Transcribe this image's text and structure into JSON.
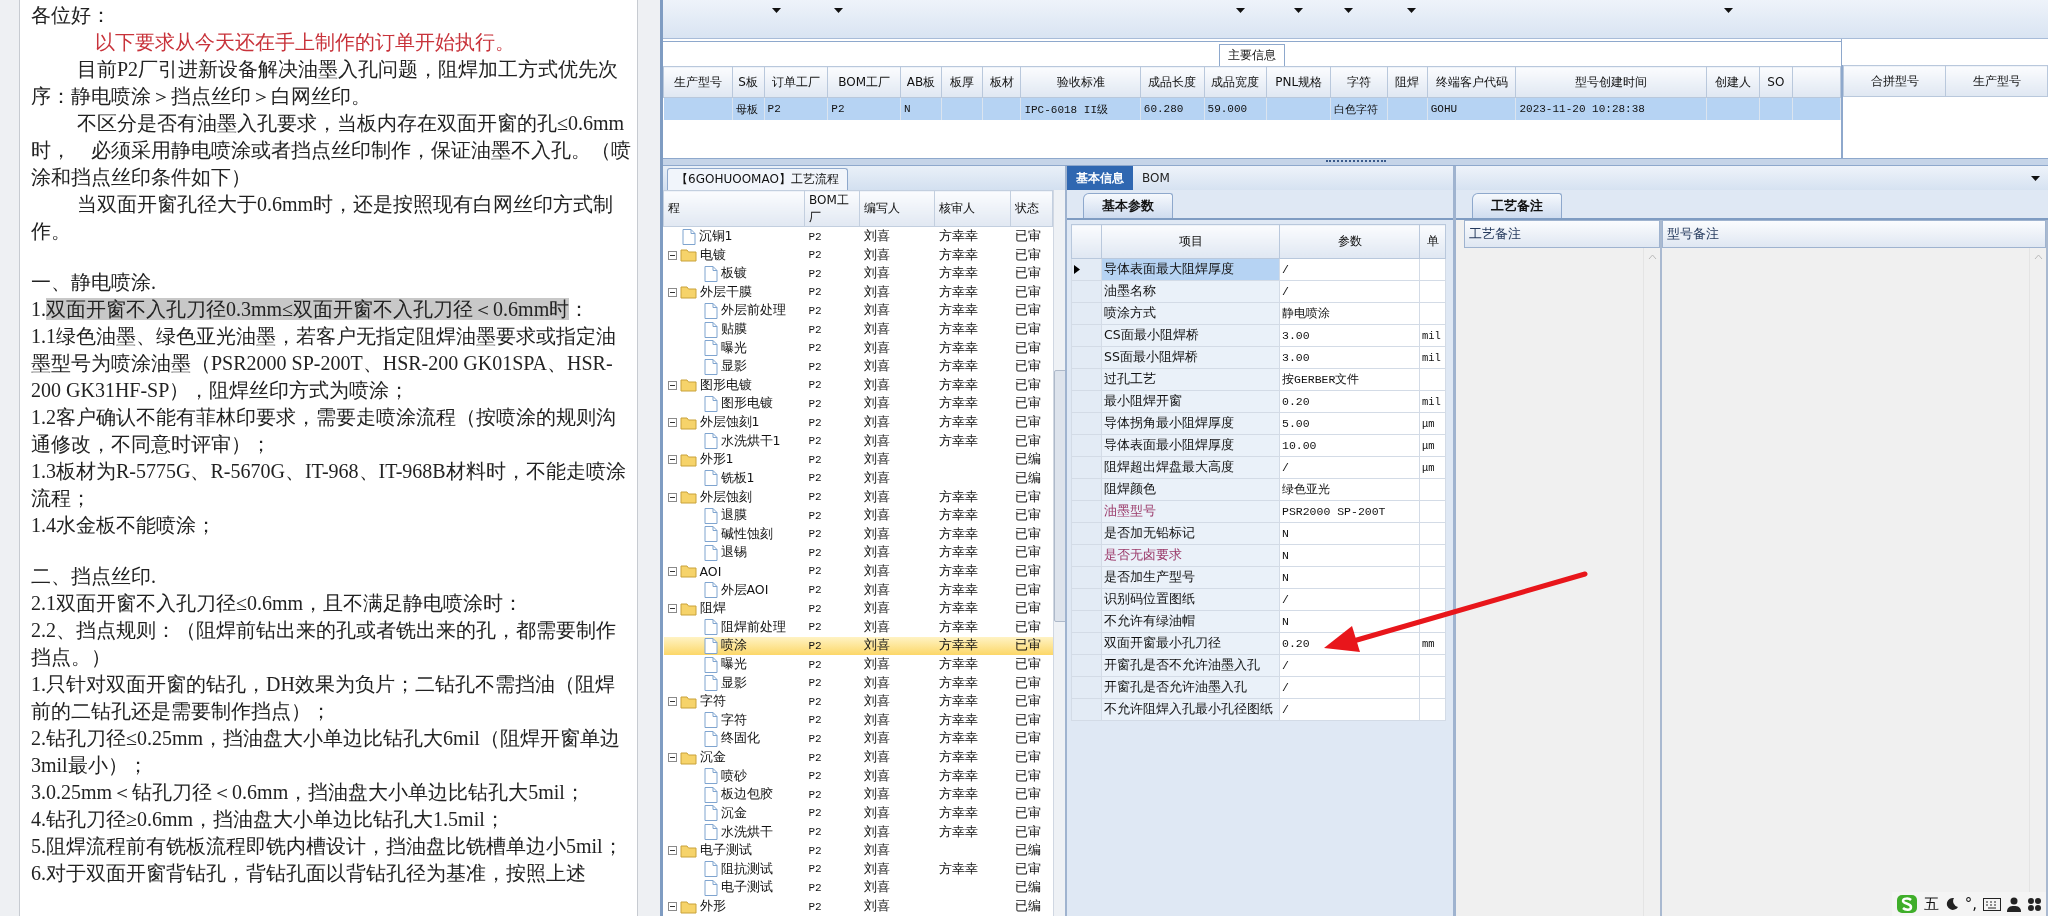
{
  "document": {
    "paragraphs": [
      {
        "kind": "greeting",
        "text": "各位好："
      },
      {
        "kind": "notice",
        "text": "以下要求从今天还在手上制作的订单开始执行。"
      },
      {
        "kind": "indent",
        "text": "目前P2厂引进新设备解决油墨入孔问题，阻焊加工方式优先次序：静电喷涂＞挡点丝印＞白网丝印。"
      },
      {
        "kind": "indent",
        "text": "不区分是否有油墨入孔要求，当板内存在双面开窗的孔≤0.6mm时，　必须采用静电喷涂或者挡点丝印制作，保证油墨不入孔。（喷涂和挡点丝印条件如下）"
      },
      {
        "kind": "indent",
        "text": "当双面开窗孔径大于0.6mm时，还是按照现有白网丝印方式制作。"
      },
      {
        "kind": "heading",
        "text": "一、静电喷涂."
      },
      {
        "kind": "body",
        "text": "1.",
        "highlight": "双面开窗不入孔刀径0.3mm≤双面开窗不入孔刀径＜0.6mm时",
        "tail": "："
      },
      {
        "kind": "body",
        "text": "1.1绿色油墨、绿色亚光油墨，若客户无指定阻焊油墨要求或指定油墨型号为喷涂油墨（PSR2000 SP-200T、HSR-200 GK01SPA、HSR-200 GK31HF-SP），阻焊丝印方式为喷涂；"
      },
      {
        "kind": "body",
        "text": "1.2客户确认不能有菲林印要求，需要走喷涂流程（按喷涂的规则沟通修改，不同意时评审）；"
      },
      {
        "kind": "body",
        "text": "1.3板材为R-5775G、R-5670G、IT-968、IT-968B材料时，不能走喷涂流程；"
      },
      {
        "kind": "body",
        "text": "1.4水金板不能喷涂；"
      },
      {
        "kind": "heading",
        "text": "二、挡点丝印."
      },
      {
        "kind": "body",
        "text": "2.1双面开窗不入孔刀径≤0.6mm，且不满足静电喷涂时："
      },
      {
        "kind": "body",
        "text": "2.2、挡点规则：（阻焊前钻出来的孔或者铣出来的孔，都需要制作挡点。）"
      },
      {
        "kind": "body",
        "text": "1.只针对双面开窗的钻孔，DH效果为负片；二钻孔不需挡油（阻焊前的二钻孔还是需要制作挡点）；"
      },
      {
        "kind": "body",
        "text": "2.钻孔刀径≤0.25mm，挡油盘大小单边比钻孔大6mil（阻焊开窗单边3mil最小）；"
      },
      {
        "kind": "body",
        "text": "3.0.25mm＜钻孔刀径＜0.6mm，挡油盘大小单边比钻孔大5mil；"
      },
      {
        "kind": "body",
        "text": "4.钻孔刀径≥0.6mm，挡油盘大小单边比钻孔大1.5mil；"
      },
      {
        "kind": "body",
        "text": "5.阻焊流程前有铣板流程即铣内槽设计，挡油盘比铣槽单边小5mil；"
      },
      {
        "kind": "body",
        "text": "6.对于双面开窗背钻孔，背钻孔面以背钻孔径为基准，按照上述"
      }
    ]
  },
  "main_info": {
    "title": "主要信息",
    "columns": [
      "生产型号",
      "S板",
      "订单工厂",
      "BOM工厂",
      "AB板",
      "板厚",
      "板材",
      "验收标准",
      "成品长度",
      "成品宽度",
      "PNL规格",
      "字符",
      "阻焊",
      "终端客户代码",
      "型号创建时间",
      "创建人",
      "SO"
    ],
    "rows": [
      {
        "selected": true,
        "cells": [
          null,
          "母板",
          "P2",
          "P2",
          "N",
          null,
          null,
          "IPC-6018 II级",
          "60.280",
          "59.000",
          null,
          "白色字符",
          null,
          "GOHU",
          "2023-11-20 10:28:38",
          null,
          null
        ]
      }
    ],
    "side_columns": [
      "合拼型号",
      "生产型号"
    ]
  },
  "process_tree": {
    "tab": "【6GOHUOOMAO】工艺流程",
    "columns": [
      "程",
      "BOM工厂",
      "编写人",
      "核审人",
      "状态"
    ],
    "items": [
      {
        "name": "沉铜1",
        "bom": "P2",
        "writer": "刘喜",
        "reviewer": "方幸幸",
        "status": "已审",
        "selected": false
      },
      {
        "name": "电镀",
        "bom": "P2",
        "writer": "刘喜",
        "reviewer": "方幸幸",
        "status": "已审",
        "selected": false,
        "expanded": true,
        "children": [
          {
            "name": "板镀",
            "bom": "P2",
            "writer": "刘喜",
            "reviewer": "方幸幸",
            "status": "已审",
            "selected": false
          }
        ]
      },
      {
        "name": "外层干膜",
        "bom": "P2",
        "writer": "刘喜",
        "reviewer": "方幸幸",
        "status": "已审",
        "selected": false,
        "expanded": true,
        "children": [
          {
            "name": "外层前处理",
            "bom": "P2",
            "writer": "刘喜",
            "reviewer": "方幸幸",
            "status": "已审",
            "selected": false
          },
          {
            "name": "贴膜",
            "bom": "P2",
            "writer": "刘喜",
            "reviewer": "方幸幸",
            "status": "已审",
            "selected": false
          },
          {
            "name": "曝光",
            "bom": "P2",
            "writer": "刘喜",
            "reviewer": "方幸幸",
            "status": "已审",
            "selected": false
          },
          {
            "name": "显影",
            "bom": "P2",
            "writer": "刘喜",
            "reviewer": "方幸幸",
            "status": "已审",
            "selected": false
          }
        ]
      },
      {
        "name": "图形电镀",
        "bom": "P2",
        "writer": "刘喜",
        "reviewer": "方幸幸",
        "status": "已审",
        "selected": false,
        "expanded": true,
        "children": [
          {
            "name": "图形电镀",
            "bom": "P2",
            "writer": "刘喜",
            "reviewer": "方幸幸",
            "status": "已审",
            "selected": false
          }
        ]
      },
      {
        "name": "外层蚀刻1",
        "bom": "P2",
        "writer": "刘喜",
        "reviewer": "方幸幸",
        "status": "已审",
        "selected": false,
        "expanded": true,
        "children": [
          {
            "name": "水洗烘干1",
            "bom": "P2",
            "writer": "刘喜",
            "reviewer": "方幸幸",
            "status": "已审",
            "selected": false
          }
        ]
      },
      {
        "name": "外形1",
        "bom": "P2",
        "writer": "刘喜",
        "status": "已编",
        "selected": false,
        "expanded": true,
        "children": [
          {
            "name": "铣板1",
            "bom": "P2",
            "writer": "刘喜",
            "status": "已编",
            "selected": false
          }
        ]
      },
      {
        "name": "外层蚀刻",
        "bom": "P2",
        "writer": "刘喜",
        "reviewer": "方幸幸",
        "status": "已审",
        "selected": false,
        "expanded": true,
        "children": [
          {
            "name": "退膜",
            "bom": "P2",
            "writer": "刘喜",
            "reviewer": "方幸幸",
            "status": "已审",
            "selected": false
          },
          {
            "name": "碱性蚀刻",
            "bom": "P2",
            "writer": "刘喜",
            "reviewer": "方幸幸",
            "status": "已审",
            "selected": false
          },
          {
            "name": "退锡",
            "bom": "P2",
            "writer": "刘喜",
            "reviewer": "方幸幸",
            "status": "已审",
            "selected": false
          }
        ]
      },
      {
        "name": "AOI",
        "bom": "P2",
        "writer": "刘喜",
        "reviewer": "方幸幸",
        "status": "已审",
        "selected": false,
        "expanded": true,
        "children": [
          {
            "name": "外层AOI",
            "bom": "P2",
            "writer": "刘喜",
            "reviewer": "方幸幸",
            "status": "已审",
            "selected": false
          }
        ]
      },
      {
        "name": "阻焊",
        "bom": "P2",
        "writer": "刘喜",
        "reviewer": "方幸幸",
        "status": "已审",
        "selected": false,
        "expanded": true,
        "children": [
          {
            "name": "阻焊前处理",
            "bom": "P2",
            "writer": "刘喜",
            "reviewer": "方幸幸",
            "status": "已审",
            "selected": false
          },
          {
            "name": "喷涂",
            "bom": "P2",
            "writer": "刘喜",
            "reviewer": "方幸幸",
            "status": "已审",
            "selected": true
          },
          {
            "name": "曝光",
            "bom": "P2",
            "writer": "刘喜",
            "reviewer": "方幸幸",
            "status": "已审",
            "selected": false
          },
          {
            "name": "显影",
            "bom": "P2",
            "writer": "刘喜",
            "reviewer": "方幸幸",
            "status": "已审",
            "selected": false
          }
        ]
      },
      {
        "name": "字符",
        "bom": "P2",
        "writer": "刘喜",
        "reviewer": "方幸幸",
        "status": "已审",
        "selected": false,
        "expanded": true,
        "children": [
          {
            "name": "字符",
            "bom": "P2",
            "writer": "刘喜",
            "reviewer": "方幸幸",
            "status": "已审",
            "selected": false
          },
          {
            "name": "终固化",
            "bom": "P2",
            "writer": "刘喜",
            "reviewer": "方幸幸",
            "status": "已审",
            "selected": false
          }
        ]
      },
      {
        "name": "沉金",
        "bom": "P2",
        "writer": "刘喜",
        "reviewer": "方幸幸",
        "status": "已审",
        "selected": false,
        "expanded": true,
        "children": [
          {
            "name": "喷砂",
            "bom": "P2",
            "writer": "刘喜",
            "reviewer": "方幸幸",
            "status": "已审",
            "selected": false
          },
          {
            "name": "板边包胶",
            "bom": "P2",
            "writer": "刘喜",
            "reviewer": "方幸幸",
            "status": "已审",
            "selected": false
          },
          {
            "name": "沉金",
            "bom": "P2",
            "writer": "刘喜",
            "reviewer": "方幸幸",
            "status": "已审",
            "selected": false
          },
          {
            "name": "水洗烘干",
            "bom": "P2",
            "writer": "刘喜",
            "reviewer": "方幸幸",
            "status": "已审",
            "selected": false
          }
        ]
      },
      {
        "name": "电子测试",
        "bom": "P2",
        "writer": "刘喜",
        "status": "已编",
        "selected": false,
        "expanded": true,
        "children": [
          {
            "name": "阻抗测试",
            "bom": "P2",
            "writer": "刘喜",
            "reviewer": "方幸幸",
            "status": "已审",
            "selected": false
          },
          {
            "name": "电子测试",
            "bom": "P2",
            "writer": "刘喜",
            "status": "已编",
            "selected": false
          }
        ]
      },
      {
        "name": "外形",
        "bom": "P2",
        "writer": "刘喜",
        "status": "已编",
        "selected": false,
        "expanded": true
      }
    ]
  },
  "params": {
    "tabs": [
      {
        "label": "基本信息",
        "selected": true
      },
      {
        "label": "BOM",
        "selected": false
      }
    ],
    "subtab": "基本参数",
    "columns": [
      "项目",
      "参数",
      "单"
    ],
    "rows": [
      {
        "item": "导体表面最大阻焊厚度",
        "value": "/",
        "selected": true,
        "emphasis": false
      },
      {
        "item": "油墨名称",
        "value": "/",
        "selected": false,
        "emphasis": false
      },
      {
        "item": "喷涂方式",
        "value": "静电喷涂",
        "selected": false,
        "emphasis": false
      },
      {
        "item": "CS面最小阻焊桥",
        "value": "3.00",
        "unit": "mil",
        "selected": false,
        "emphasis": false
      },
      {
        "item": "SS面最小阻焊桥",
        "value": "3.00",
        "unit": "mil",
        "selected": false,
        "emphasis": false
      },
      {
        "item": "过孔工艺",
        "value": "按GERBER文件",
        "selected": false,
        "emphasis": false
      },
      {
        "item": "最小阻焊开窗",
        "value": "0.20",
        "unit": "mil",
        "selected": false,
        "emphasis": false
      },
      {
        "item": "导体拐角最小阻焊厚度",
        "value": "5.00",
        "unit": "μm",
        "selected": false,
        "emphasis": false
      },
      {
        "item": "导体表面最小阻焊厚度",
        "value": "10.00",
        "unit": "μm",
        "selected": false,
        "emphasis": false
      },
      {
        "item": "阻焊超出焊盘最大高度",
        "value": "/",
        "unit": "μm",
        "selected": false,
        "emphasis": false
      },
      {
        "item": "阻焊颜色",
        "value": "绿色亚光",
        "selected": false,
        "emphasis": false
      },
      {
        "item": "油墨型号",
        "value": "PSR2000 SP-200T",
        "selected": false,
        "emphasis": true
      },
      {
        "item": "是否加无铅标记",
        "value": "N",
        "selected": false,
        "emphasis": false
      },
      {
        "item": "是否无卤要求",
        "value": "N",
        "selected": false,
        "emphasis": true
      },
      {
        "item": "是否加生产型号",
        "value": "N",
        "selected": false,
        "emphasis": false
      },
      {
        "item": "识别码位置图纸",
        "value": "/",
        "selected": false,
        "emphasis": false
      },
      {
        "item": "不允许有绿油帽",
        "value": "N",
        "selected": false,
        "emphasis": false
      },
      {
        "item": "双面开窗最小孔刀径",
        "value": "0.20",
        "unit": "mm",
        "selected": false,
        "emphasis": false
      },
      {
        "item": "开窗孔是否不允许油墨入孔",
        "value": "/",
        "selected": false,
        "emphasis": false
      },
      {
        "item": "开窗孔是否允许油墨入孔",
        "value": "/",
        "selected": false,
        "emphasis": false
      },
      {
        "item": "不允许阻焊入孔最小孔径图纸",
        "value": "/",
        "selected": false,
        "emphasis": false
      }
    ]
  },
  "notes": {
    "tab": "工艺备注",
    "columns": [
      "工艺备注",
      "型号备注"
    ]
  },
  "ime": {
    "mode": "五",
    "punct": "°,"
  }
}
